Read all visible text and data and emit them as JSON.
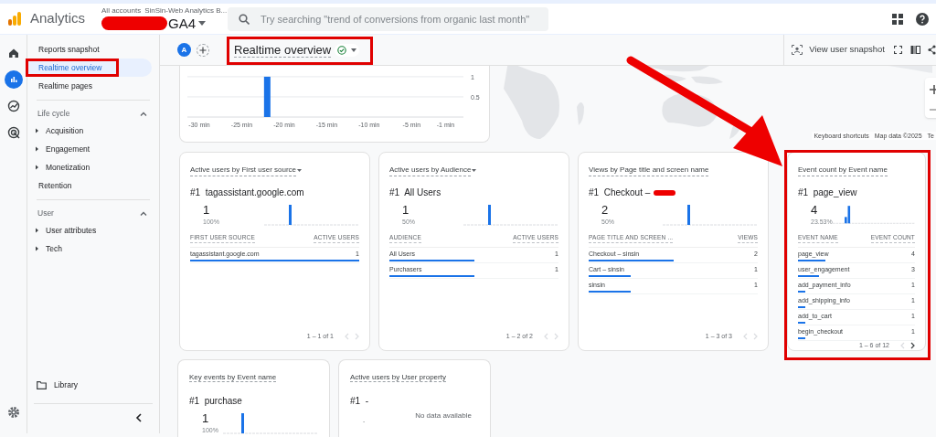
{
  "header": {
    "app_name": "Analytics",
    "breadcrumb": "All accounts",
    "account": "SinSin-Web Analytics B...",
    "property": "GA4",
    "property_redacted": true,
    "search": {
      "placeholder": "Try searching \"trend of conversions from organic last month\""
    }
  },
  "rail": [
    {
      "kind": "home",
      "selected": false
    },
    {
      "kind": "reports",
      "selected": true
    },
    {
      "kind": "explore",
      "selected": false
    },
    {
      "kind": "advertising",
      "selected": false
    }
  ],
  "nav": {
    "items": [
      {
        "kind": "item",
        "label": "Reports snapshot",
        "selected": false,
        "annotated": false
      },
      {
        "kind": "item",
        "label": "Realtime overview",
        "selected": true,
        "annotated": true
      },
      {
        "kind": "item",
        "label": "Realtime pages",
        "selected": false,
        "annotated": false
      },
      {
        "kind": "section",
        "label": "Life cycle",
        "expanded": true
      },
      {
        "kind": "group",
        "label": "Acquisition",
        "expanded": false
      },
      {
        "kind": "group",
        "label": "Engagement",
        "expanded": false
      },
      {
        "kind": "group",
        "label": "Monetization",
        "expanded": false
      },
      {
        "kind": "item",
        "label": "Retention",
        "selected": false,
        "annotated": false
      },
      {
        "kind": "section",
        "label": "User",
        "expanded": true
      },
      {
        "kind": "group",
        "label": "User attributes",
        "expanded": false
      },
      {
        "kind": "group",
        "label": "Tech",
        "expanded": false
      }
    ],
    "library": "Library"
  },
  "toolbar": {
    "comparison_badge": "A",
    "title": "Realtime overview",
    "title_annotated": true,
    "snapshot_button": "View user snapshot"
  },
  "timeline": {
    "chart_data": {
      "type": "bar",
      "x": [
        -22
      ],
      "values": [
        1
      ],
      "xlim": [
        -31.4,
        1.1
      ],
      "ylim": [
        0,
        1.27
      ],
      "xticks": [
        {
          "value": -30,
          "label": "-30 min"
        },
        {
          "value": -25,
          "label": "-25 min"
        },
        {
          "value": -20,
          "label": "-20 min"
        },
        {
          "value": -15,
          "label": "-15 min"
        },
        {
          "value": -10,
          "label": "-10 min"
        },
        {
          "value": -5,
          "label": "-5 min"
        },
        {
          "value": -1,
          "label": "-1 min"
        }
      ],
      "yticks": [
        0.5,
        1
      ]
    }
  },
  "map": {
    "keyboard_shortcuts": "Keyboard shortcuts",
    "map_data": "Map data ©2025",
    "terms": "Te"
  },
  "cards": [
    {
      "title": "Active users by First user source",
      "title_dropdown": true,
      "top": "#1  tagassistant.google.com",
      "top_redacted": false,
      "value": "1",
      "share": "100%",
      "columns": [
        "FIRST USER SOURCE",
        "ACTIVE USERS"
      ],
      "rows": [
        {
          "label": "tagassistant.google.com",
          "value": "1",
          "level": 1
        }
      ],
      "pagination": "1 – 1 of 1",
      "next_enabled": false,
      "annotated": false
    },
    {
      "title": "Active users by Audience",
      "title_dropdown": true,
      "top": "#1  All Users",
      "top_redacted": false,
      "value": "1",
      "share": "50%",
      "columns": [
        "AUDIENCE",
        "ACTIVE USERS"
      ],
      "rows": [
        {
          "label": "All Users",
          "value": "1",
          "level": 0.5
        },
        {
          "label": "Purchasers",
          "value": "1",
          "level": 0.5
        }
      ],
      "pagination": "1 – 2 of 2",
      "next_enabled": false,
      "annotated": false
    },
    {
      "title": "Views by Page title and screen name",
      "title_dropdown": false,
      "top": "#1  Checkout –",
      "top_redacted": true,
      "value": "2",
      "share": "50%",
      "columns": [
        "PAGE TITLE AND SCREEN ...",
        "VIEWS"
      ],
      "rows": [
        {
          "label": "Checkout – sinsin",
          "value": "2",
          "level": 0.5
        },
        {
          "label": "Cart – sinsin",
          "value": "1",
          "level": 0.25
        },
        {
          "label": "sinsin",
          "value": "1",
          "level": 0.25
        }
      ],
      "pagination": "1 – 3 of 3",
      "next_enabled": false,
      "annotated": false
    },
    {
      "title": "Event count by Event name",
      "title_dropdown": false,
      "top": "#1  page_view",
      "top_redacted": false,
      "value": "4",
      "share": "23.53%",
      "columns": [
        "EVENT NAME",
        "EVENT COUNT"
      ],
      "rows": [
        {
          "label": "page_view",
          "value": "4",
          "level": 0.2353
        },
        {
          "label": "user_engagement",
          "value": "3",
          "level": 0.1765
        },
        {
          "label": "add_payment_info",
          "value": "1",
          "level": 0.0588
        },
        {
          "label": "add_shipping_info",
          "value": "1",
          "level": 0.0588
        },
        {
          "label": "add_to_cart",
          "value": "1",
          "level": 0.0588
        },
        {
          "label": "begin_checkout",
          "value": "1",
          "level": 0.0588
        }
      ],
      "pagination": "1 – 6 of 12",
      "next_enabled": true,
      "annotated": true
    }
  ],
  "lower_cards": [
    {
      "title": "Key events by Event name",
      "top": "#1  purchase",
      "value": "1",
      "share": "100%",
      "has_data": true
    },
    {
      "title": "Active users by User property",
      "top": "#1  -",
      "value": "-",
      "has_data": false,
      "empty_message": "No data available"
    }
  ]
}
